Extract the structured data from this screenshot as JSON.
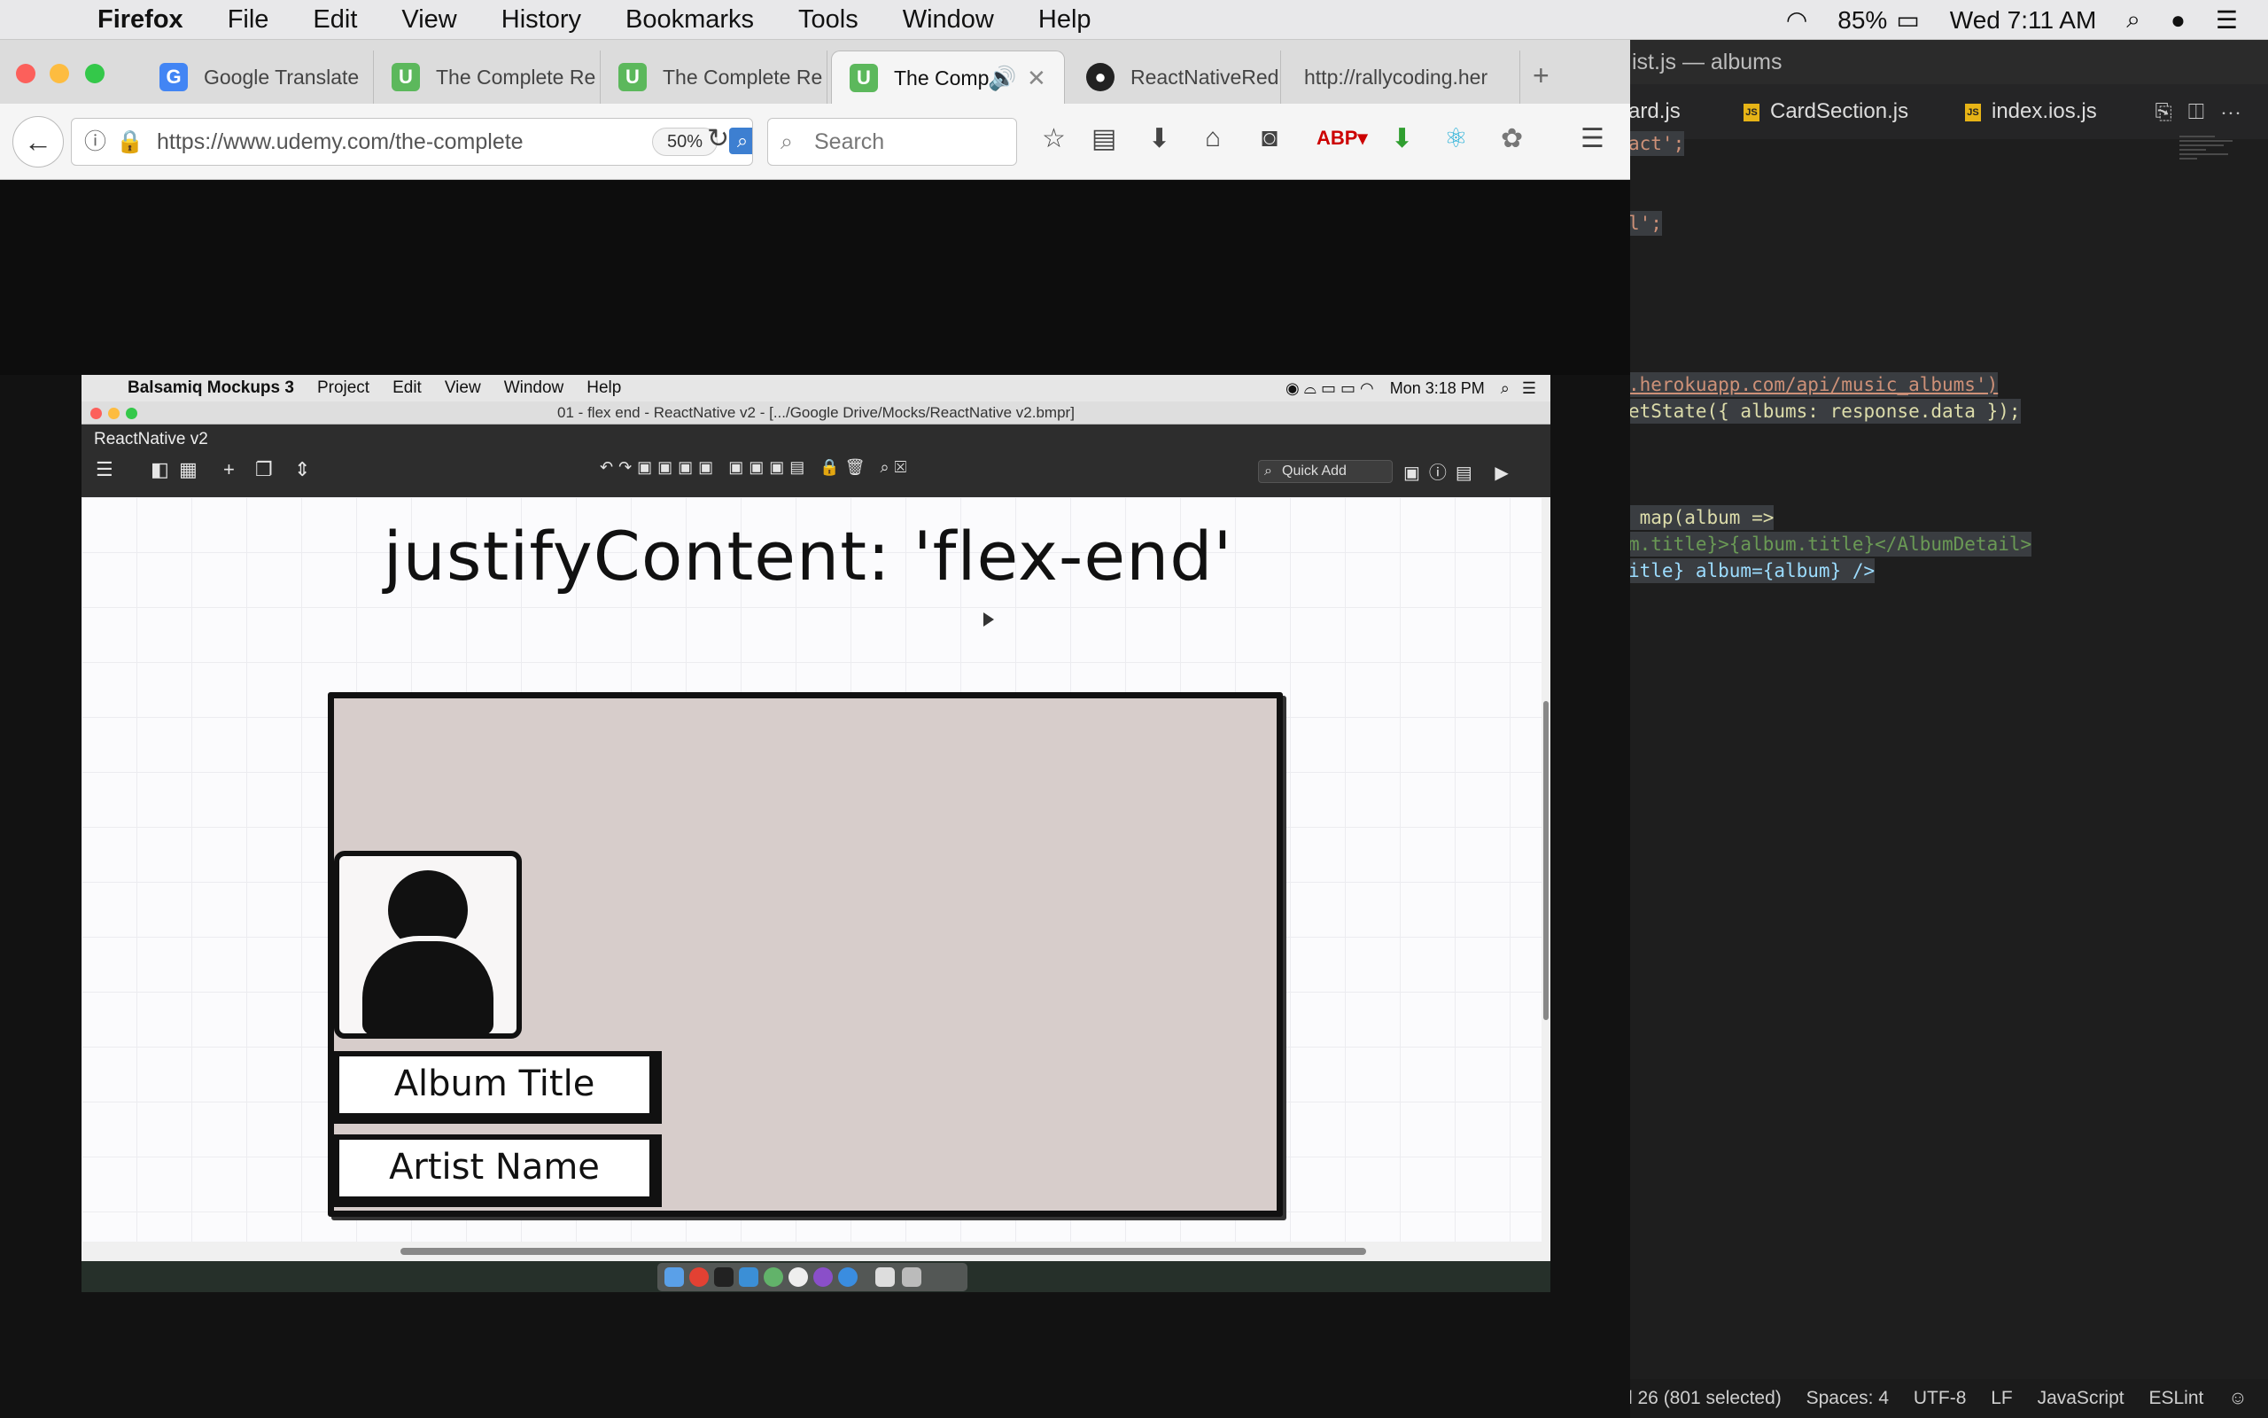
{
  "mac_menubar": {
    "app": "Firefox",
    "menus": [
      "File",
      "Edit",
      "View",
      "History",
      "Bookmarks",
      "Tools",
      "Window",
      "Help"
    ],
    "battery": "85%",
    "clock": "Wed 7:11 AM"
  },
  "firefox": {
    "tabs": [
      {
        "label": "Google Translate",
        "icon": "google-translate-icon"
      },
      {
        "label": "The Complete Re",
        "icon": "udemy-icon"
      },
      {
        "label": "The Complete Re",
        "icon": "udemy-icon"
      },
      {
        "label": "The Comp",
        "icon": "udemy-icon",
        "active": true
      },
      {
        "label": "ReactNativeRedu",
        "icon": "github-icon"
      },
      {
        "label": "http://rallycoding.her",
        "icon": ""
      }
    ],
    "url": "https://www.udemy.com/the-complete",
    "zoom": "50%",
    "search_placeholder": "Search"
  },
  "balsamiq": {
    "menubar": {
      "app": "Balsamiq Mockups 3",
      "menus": [
        "Project",
        "Edit",
        "View",
        "Window",
        "Help"
      ],
      "clock": "Mon 3:18 PM"
    },
    "window_title": "01 - flex end - ReactNative v2 - [.../Google Drive/Mocks/ReactNative v2.bmpr]",
    "project_name": "ReactNative v2",
    "quick_add": "Quick Add",
    "mockup": {
      "heading": "justifyContent: 'flex-end'",
      "album_title": "Album Title",
      "artist_name": "Artist Name"
    }
  },
  "editor": {
    "title": "ist.js — albums",
    "tabs": [
      "ard.js",
      "CardSection.js",
      "index.ios.js"
    ],
    "code_lines": [
      "act';",
      "l';",
      ".herokuapp.com/api/music_albums')",
      "etState({ albums: response.data });",
      " map(album =>",
      "m.title}>{album.title}</AlbumDetail>",
      "itle} album={album} />"
    ],
    "status": {
      "position": "l 26 (801 selected)",
      "spaces": "Spaces: 4",
      "encoding": "UTF-8",
      "line_ending": "LF",
      "language": "JavaScript",
      "linter": "ESLint"
    }
  },
  "colors": {
    "udemy": "#5cb85c",
    "card_fill": "#d7cdcb",
    "editor_bg": "#1e1e1e"
  }
}
